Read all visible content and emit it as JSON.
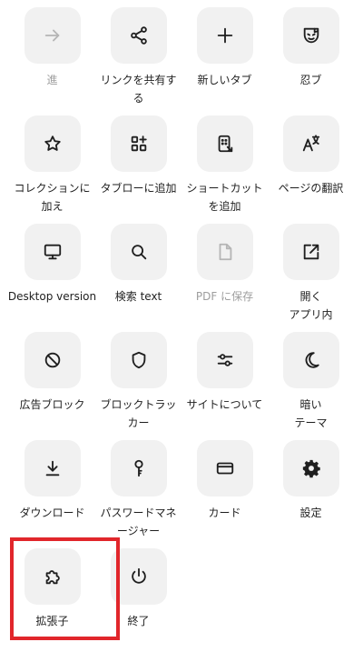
{
  "menu": {
    "items": [
      {
        "label": "進",
        "icon": "arrow-forward-icon",
        "disabled": true
      },
      {
        "label": "リンクを共有す\nる",
        "icon": "share-icon",
        "disabled": false
      },
      {
        "label": "新しいタブ",
        "icon": "plus-icon",
        "disabled": false
      },
      {
        "label": "忍ブ",
        "icon": "incognito-icon",
        "disabled": false
      },
      {
        "label": "コレクションに\n加え",
        "icon": "star-icon",
        "disabled": false
      },
      {
        "label": "タブローに追加",
        "icon": "grid-plus-icon",
        "disabled": false
      },
      {
        "label": "ショートカット\nを追加",
        "icon": "shortcut-icon",
        "disabled": false
      },
      {
        "label": "ページの翻訳",
        "icon": "translate-icon",
        "disabled": false
      },
      {
        "label": "Desktop version",
        "icon": "desktop-icon",
        "disabled": false
      },
      {
        "label": "検索 text",
        "icon": "search-icon",
        "disabled": false
      },
      {
        "label": "PDF に保存",
        "icon": "file-icon",
        "disabled": true
      },
      {
        "label": "開く\nアプリ内",
        "icon": "open-external-icon",
        "disabled": false
      },
      {
        "label": "広告ブロック",
        "icon": "block-icon",
        "disabled": false
      },
      {
        "label": "ブロックトラッ\nカー",
        "icon": "shield-icon",
        "disabled": false
      },
      {
        "label": "サイトについて",
        "icon": "sliders-icon",
        "disabled": false
      },
      {
        "label": "暗い\nテーマ",
        "icon": "moon-icon",
        "disabled": false
      },
      {
        "label": "ダウンロード",
        "icon": "download-icon",
        "disabled": false
      },
      {
        "label": "パスワードマネ\nージャー",
        "icon": "key-icon",
        "disabled": false
      },
      {
        "label": "カード",
        "icon": "card-icon",
        "disabled": false
      },
      {
        "label": "設定",
        "icon": "gear-icon",
        "disabled": false
      },
      {
        "label": "拡張子",
        "icon": "puzzle-icon",
        "disabled": false,
        "highlighted": true
      },
      {
        "label": "終了",
        "icon": "power-icon",
        "disabled": false
      }
    ]
  },
  "colors": {
    "tile_bg": "#f1f1f1",
    "highlight": "#e1262b",
    "disabled_text": "#9e9e9e"
  }
}
